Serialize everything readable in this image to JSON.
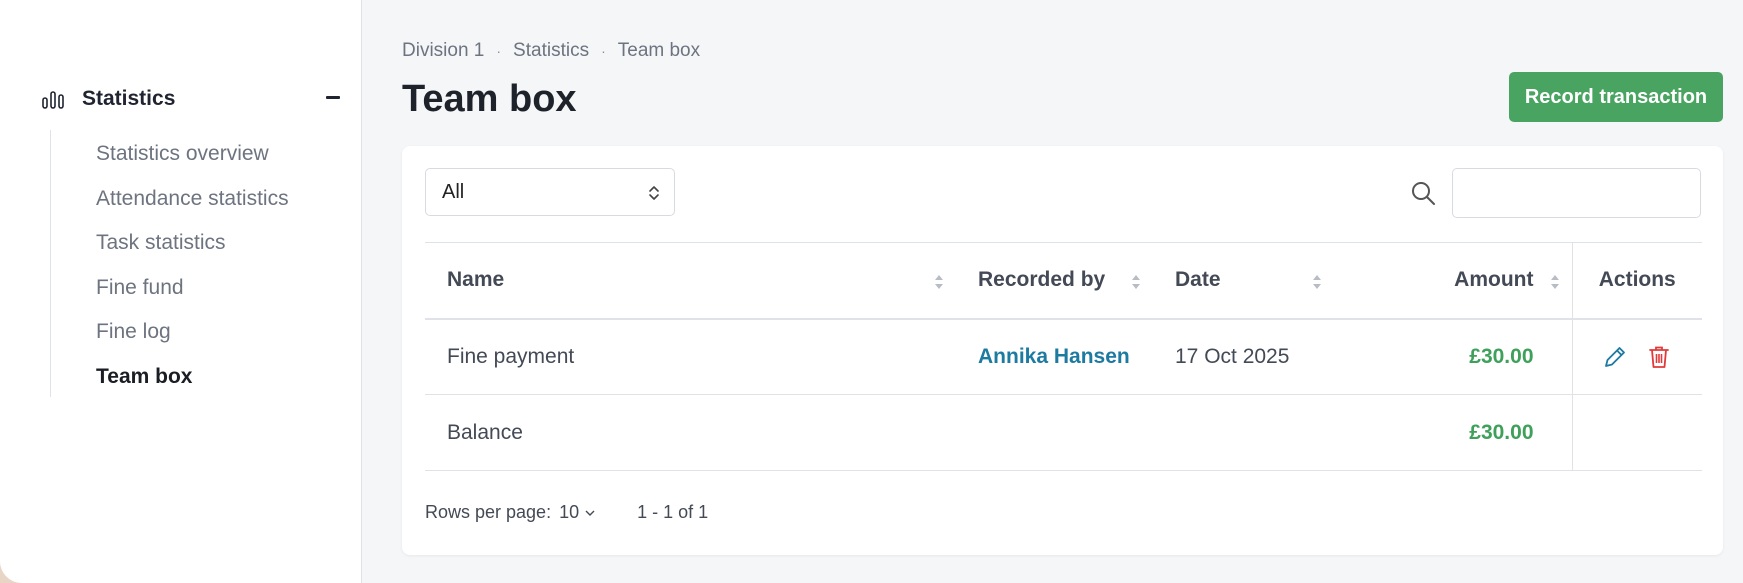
{
  "sidebar": {
    "section_title": "Statistics",
    "items": [
      {
        "label": "Statistics overview",
        "active": false
      },
      {
        "label": "Attendance statistics",
        "active": false
      },
      {
        "label": "Task statistics",
        "active": false
      },
      {
        "label": "Fine fund",
        "active": false
      },
      {
        "label": "Fine log",
        "active": false
      },
      {
        "label": "Team box",
        "active": true
      }
    ]
  },
  "breadcrumb": [
    "Division 1",
    "Statistics",
    "Team box"
  ],
  "page": {
    "title": "Team box",
    "primary_button": "Record transaction"
  },
  "filter": {
    "selected": "All",
    "search_value": ""
  },
  "table": {
    "columns": {
      "name": "Name",
      "recorded_by": "Recorded by",
      "date": "Date",
      "amount": "Amount",
      "actions": "Actions"
    },
    "rows": [
      {
        "name": "Fine payment",
        "recorded_by": "Annika Hansen",
        "date": "17 Oct 2025",
        "amount": "£30.00"
      }
    ],
    "balance": {
      "label": "Balance",
      "amount": "£30.00"
    }
  },
  "pagination": {
    "rows_per_page_label": "Rows per page:",
    "rows_per_page": "10",
    "range": "1 - 1 of 1"
  },
  "colors": {
    "accent_green": "#4aa461",
    "amount_green": "#3ea05a",
    "link_blue": "#1d7aa1",
    "delete_red": "#e03a3a"
  }
}
